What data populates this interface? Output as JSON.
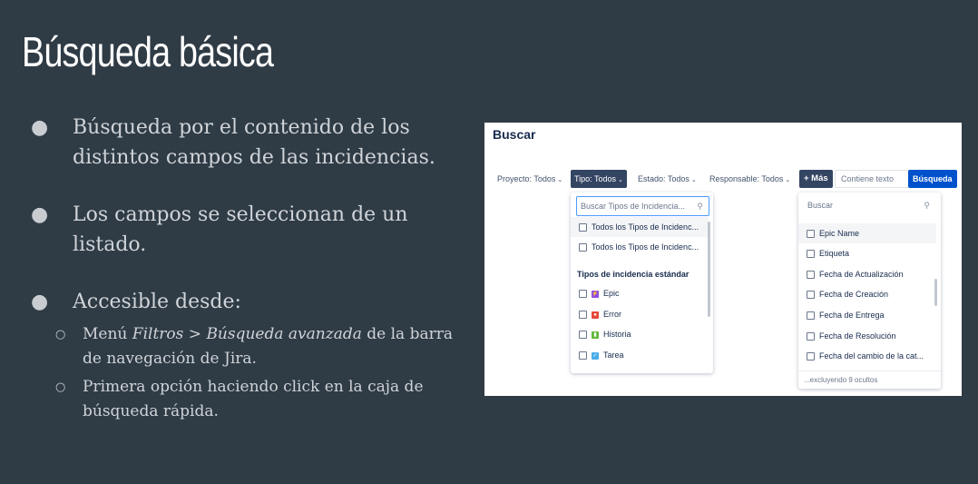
{
  "slide": {
    "title": "Búsqueda básica",
    "bullet_glyph": "●",
    "sub_glyph": "○",
    "bullets": [
      "Búsqueda por el contenido de los distintos campos de las incidencias.",
      "Los campos se seleccionan de un listado.",
      "Accesible desde:"
    ],
    "sub_bullets": {
      "menu_prefix": "Menú ",
      "menu_filtros": "Filtros",
      "menu_sep": " > ",
      "menu_avanzada": "Búsqueda avanzada",
      "menu_suffix": " de la barra de navegación de Jira.",
      "second": "Primera opción haciendo click en la caja de búsqueda rápida."
    }
  },
  "jira": {
    "title": "Buscar",
    "filters": {
      "proyecto": "Proyecto: Todos",
      "tipo": "Tipo: Todos",
      "estado": "Estado: Todos",
      "responsable": "Responsable: Todos",
      "mas": "+ Más",
      "text_placeholder": "Contiene texto",
      "search_button": "Búsqueda",
      "chevron": "⌄"
    },
    "type_dropdown": {
      "search_placeholder": "Buscar Tipos de Incidencia...",
      "items_top": [
        "Todos los Tipos de Incidenc...",
        "Todos los Tipos de Incidenc..."
      ],
      "section_header": "Tipos de incidencia estándar",
      "types": [
        {
          "label": "Epic",
          "icon": "epic-icon",
          "color": "#904ee2"
        },
        {
          "label": "Error",
          "icon": "bug-icon",
          "color": "#e5493a"
        },
        {
          "label": "Historia",
          "icon": "story-icon",
          "color": "#63ba3c"
        },
        {
          "label": "Tarea",
          "icon": "task-icon",
          "color": "#4bade8"
        }
      ]
    },
    "more_dropdown": {
      "search_placeholder": "Buscar",
      "fields": [
        "Epic Name",
        "Etiqueta",
        "Fecha de Actualización",
        "Fecha de Creación",
        "Fecha de Entrega",
        "Fecha de Resolución",
        "Fecha del cambio de la cat..."
      ],
      "footer": "...excluyendo 9 ocultos"
    },
    "magnifier_glyph": "🔍",
    "check_glyph": "✓"
  }
}
